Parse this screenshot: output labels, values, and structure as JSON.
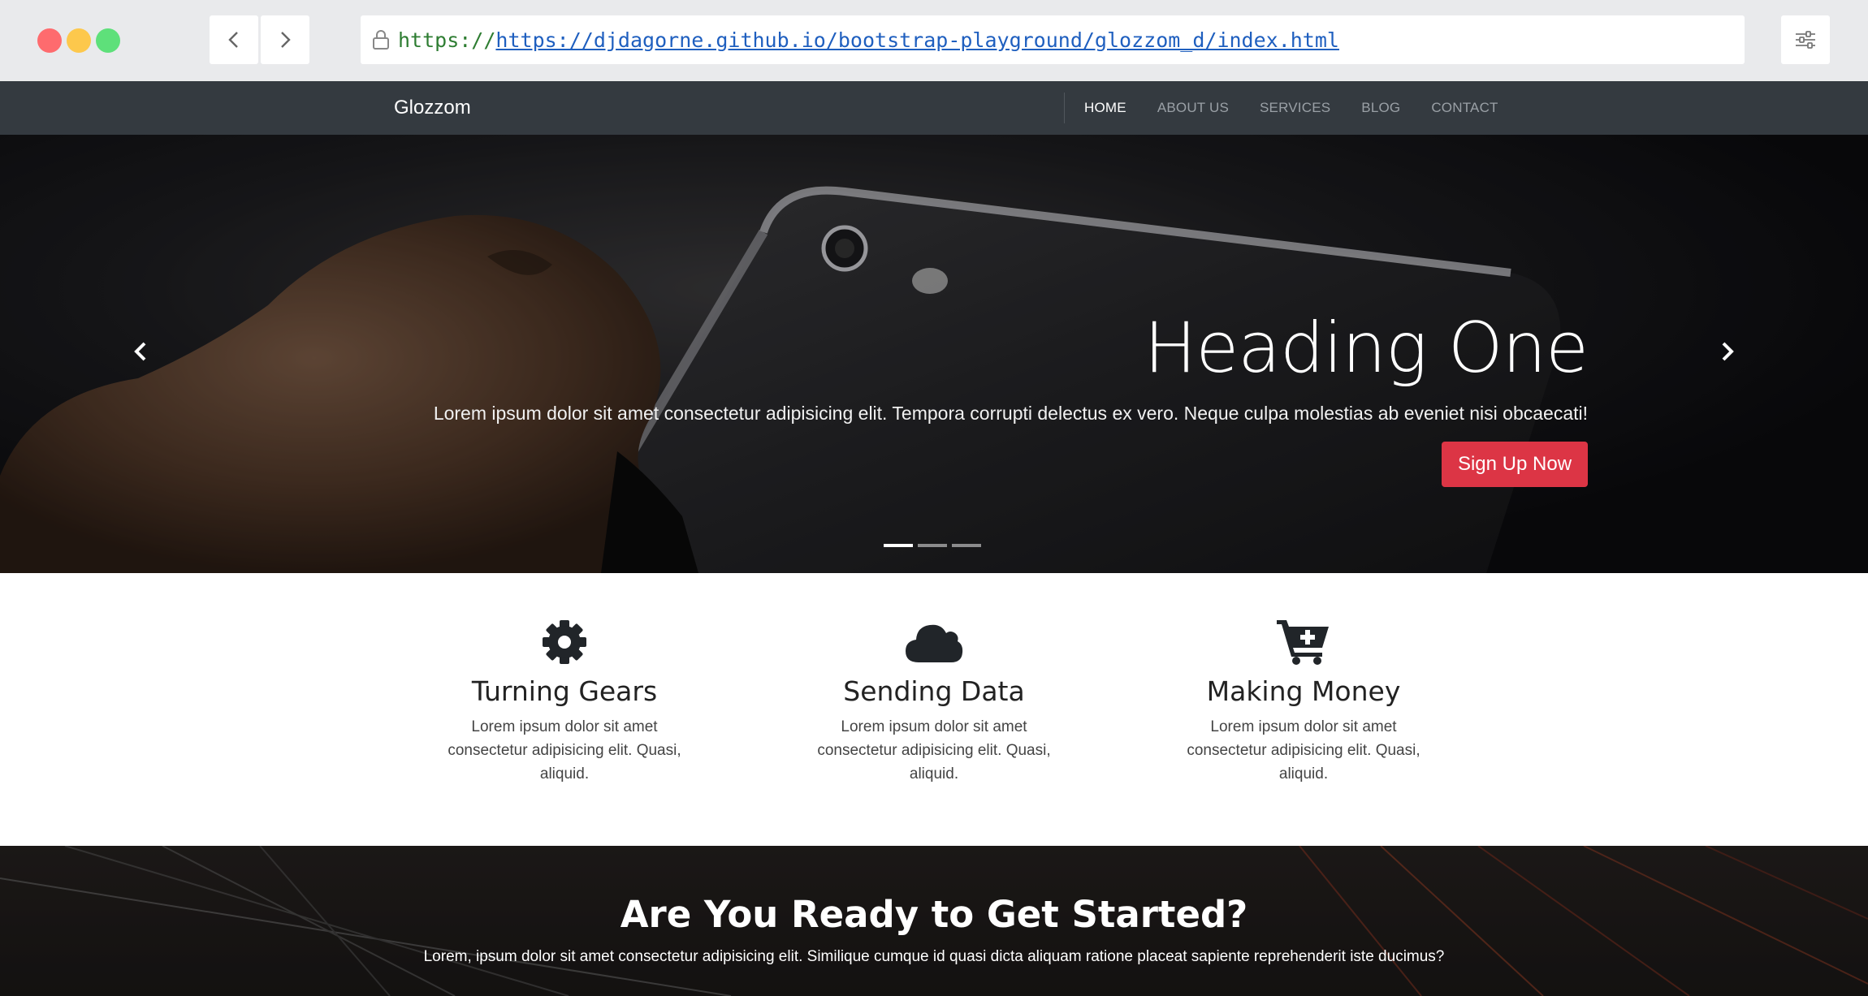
{
  "browser": {
    "url_scheme": "https://",
    "url_link": "https://djdagorne.github.io/bootstrap-playground/glozzom_d/index.html",
    "icons": [
      "back-icon",
      "forward-icon",
      "lock-icon",
      "settings-sliders-icon"
    ]
  },
  "site": {
    "brand": "Glozzom",
    "nav": [
      "HOME",
      "ABOUT US",
      "SERVICES",
      "BLOG",
      "CONTACT"
    ],
    "active_nav": "HOME"
  },
  "hero": {
    "heading": "Heading One",
    "lead": "Lorem ipsum dolor sit amet consectetur adipisicing elit. Tempora corrupti delectus ex vero. Neque culpa molestias ab eveniet nisi obcaecati!",
    "cta": "Sign Up Now",
    "cta_color": "#dc3545",
    "slides": 3,
    "active_slide": 1
  },
  "features": [
    {
      "icon": "gear-icon",
      "title": "Turning Gears",
      "text": "Lorem ipsum dolor sit amet consectetur adipisicing elit. Quasi, aliquid."
    },
    {
      "icon": "cloud-icon",
      "title": "Sending Data",
      "text": "Lorem ipsum dolor sit amet consectetur adipisicing elit. Quasi, aliquid."
    },
    {
      "icon": "cart-plus-icon",
      "title": "Making Money",
      "text": "Lorem ipsum dolor sit amet consectetur adipisicing elit. Quasi, aliquid."
    }
  ],
  "get_started": {
    "title": "Are You Ready to Get Started?",
    "text": "Lorem, ipsum dolor sit amet consectetur adipisicing elit. Similique cumque id quasi dicta aliquam ratione placeat sapiente reprehenderit iste ducimus?"
  }
}
